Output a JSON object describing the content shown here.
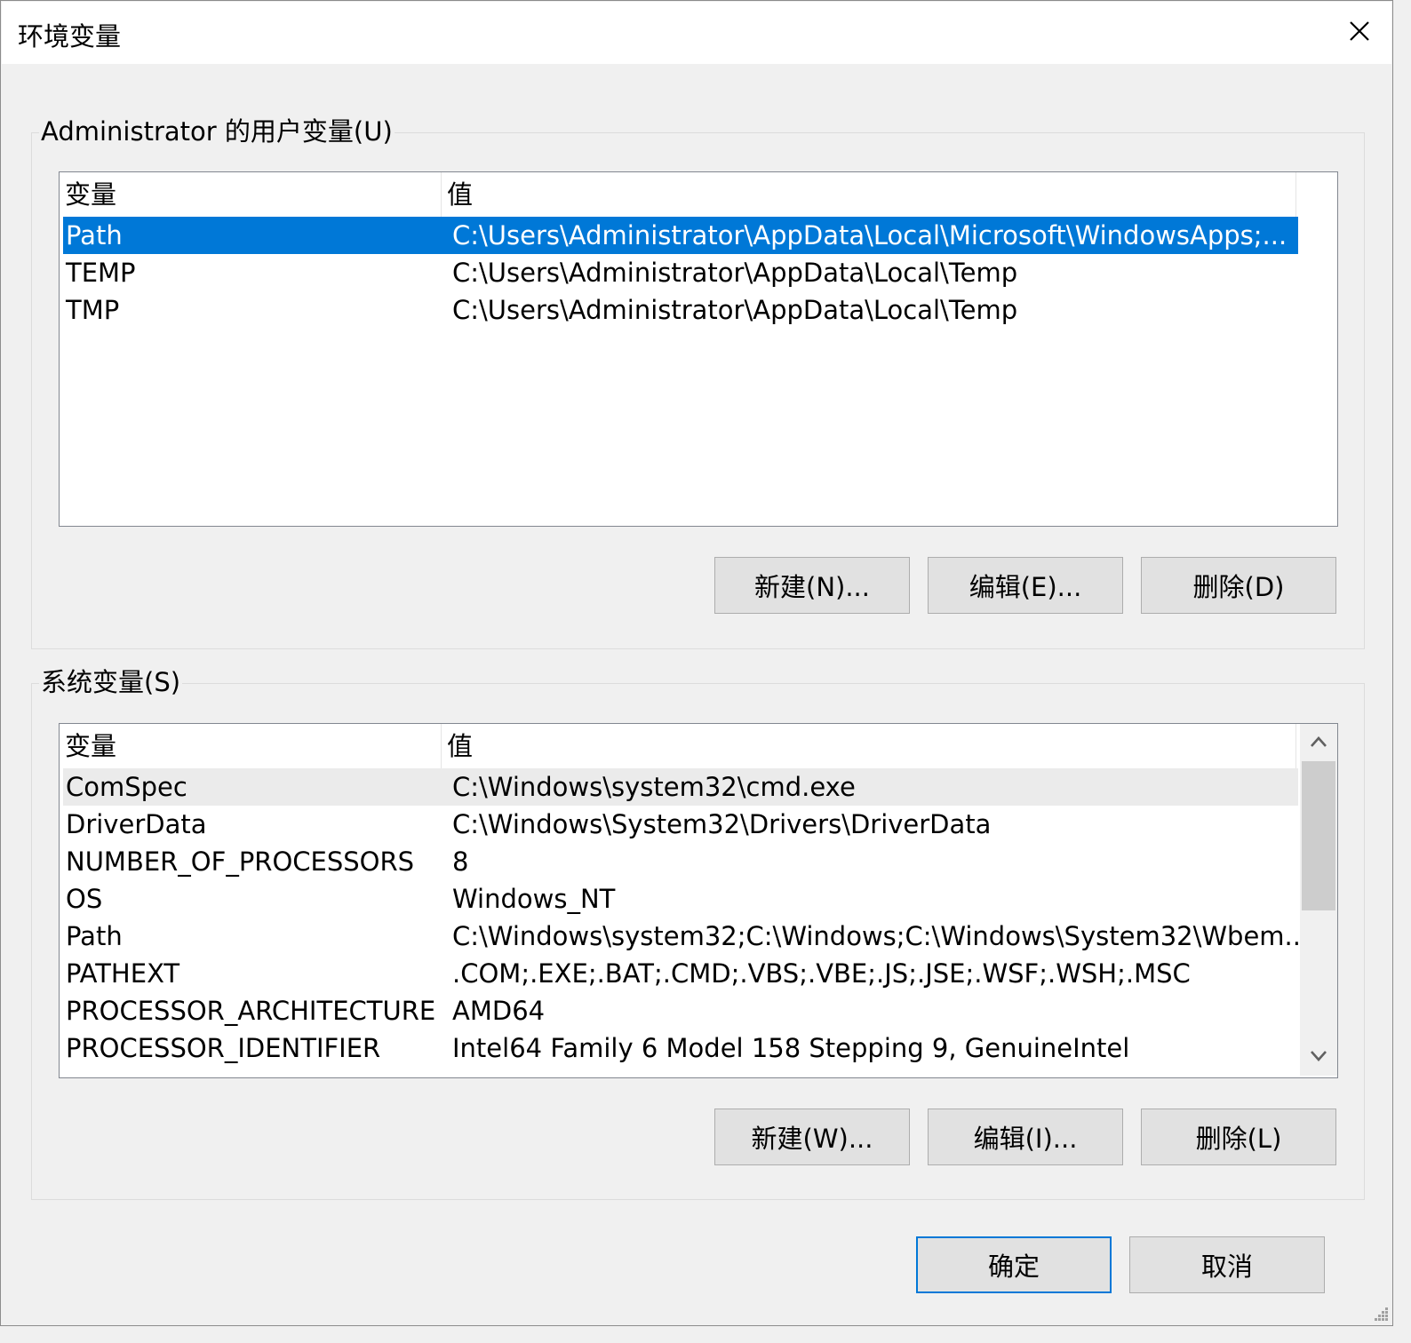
{
  "window": {
    "title": "环境变量",
    "close_icon": "close-icon"
  },
  "user_vars": {
    "legend": "Administrator 的用户变量(U)",
    "header": {
      "name": "变量",
      "value": "值"
    },
    "rows": [
      {
        "name": "Path",
        "value": "C:\\Users\\Administrator\\AppData\\Local\\Microsoft\\WindowsApps;..."
      },
      {
        "name": "TEMP",
        "value": "C:\\Users\\Administrator\\AppData\\Local\\Temp"
      },
      {
        "name": "TMP",
        "value": "C:\\Users\\Administrator\\AppData\\Local\\Temp"
      }
    ],
    "selected_row": 0,
    "buttons": {
      "new": "新建(N)...",
      "edit": "编辑(E)...",
      "delete": "删除(D)"
    }
  },
  "system_vars": {
    "legend": "系统变量(S)",
    "header": {
      "name": "变量",
      "value": "值"
    },
    "rows": [
      {
        "name": "ComSpec",
        "value": "C:\\Windows\\system32\\cmd.exe"
      },
      {
        "name": "DriverData",
        "value": "C:\\Windows\\System32\\Drivers\\DriverData"
      },
      {
        "name": "NUMBER_OF_PROCESSORS",
        "value": "8"
      },
      {
        "name": "OS",
        "value": "Windows_NT"
      },
      {
        "name": "Path",
        "value": "C:\\Windows\\system32;C:\\Windows;C:\\Windows\\System32\\Wbem..."
      },
      {
        "name": "PATHEXT",
        "value": ".COM;.EXE;.BAT;.CMD;.VBS;.VBE;.JS;.JSE;.WSF;.WSH;.MSC"
      },
      {
        "name": "PROCESSOR_ARCHITECTURE",
        "value": "AMD64"
      },
      {
        "name": "PROCESSOR_IDENTIFIER",
        "value": "Intel64 Family 6 Model 158 Stepping 9, GenuineIntel"
      }
    ],
    "hover_row": 0,
    "buttons": {
      "new": "新建(W)...",
      "edit": "编辑(I)...",
      "delete": "删除(L)"
    }
  },
  "footer": {
    "ok": "确定",
    "cancel": "取消"
  },
  "colors": {
    "selection": "#0078d7",
    "button_face": "#e1e1e1",
    "background": "#f0f0f0"
  }
}
